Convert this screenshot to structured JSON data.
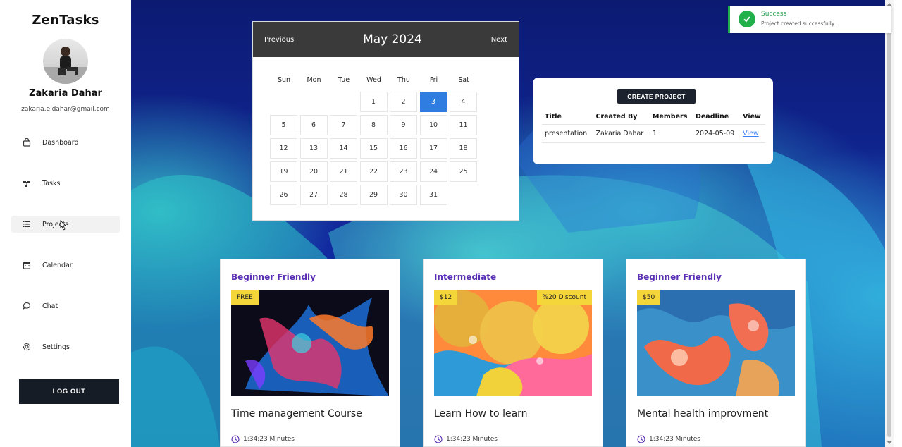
{
  "sidebar": {
    "brand": "ZenTasks",
    "user": {
      "name": "Zakaria Dahar",
      "email": "zakaria.eldahar@gmail.com"
    },
    "nav": [
      {
        "label": "Dashboard",
        "icon": "lock-icon"
      },
      {
        "label": "Tasks",
        "icon": "nodes-icon"
      },
      {
        "label": "Projects",
        "icon": "list-icon",
        "active": true
      },
      {
        "label": "Calendar",
        "icon": "calendar-icon"
      },
      {
        "label": "Chat",
        "icon": "chat-icon"
      },
      {
        "label": "Settings",
        "icon": "gear-icon"
      }
    ],
    "logout_label": "LOG OUT"
  },
  "calendar": {
    "prev_label": "Previous",
    "next_label": "Next",
    "month_title": "May 2024",
    "weekdays": [
      "Sun",
      "Mon",
      "Tue",
      "Wed",
      "Thu",
      "Fri",
      "Sat"
    ],
    "first_weekday_index": 3,
    "days_in_month": 31,
    "selected_day": 3,
    "selected_color": "#2f7de1"
  },
  "projects": {
    "create_label": "CREATE PROJECT",
    "columns": [
      "Title",
      "Created By",
      "Members",
      "Deadline",
      "View"
    ],
    "rows": [
      {
        "title": "presentation",
        "created_by": "Zakaria Dahar",
        "members": "1",
        "deadline": "2024-05-09",
        "view": "View"
      }
    ]
  },
  "toast": {
    "title": "Success",
    "message": "Project created successfully.",
    "color": "#22b04b"
  },
  "courses": [
    {
      "level": "Beginner Friendly",
      "price": "FREE",
      "discount": "",
      "title": "Time management Course",
      "duration": "1:34:23 Minutes"
    },
    {
      "level": "Intermediate",
      "price": "$12",
      "discount": "%20 Discount",
      "title": "Learn How to learn",
      "duration": "1:34:23 Minutes"
    },
    {
      "level": "Beginner Friendly",
      "price": "$50",
      "discount": "",
      "title": "Mental health improvment",
      "duration": "1:34:23 Minutes"
    }
  ]
}
